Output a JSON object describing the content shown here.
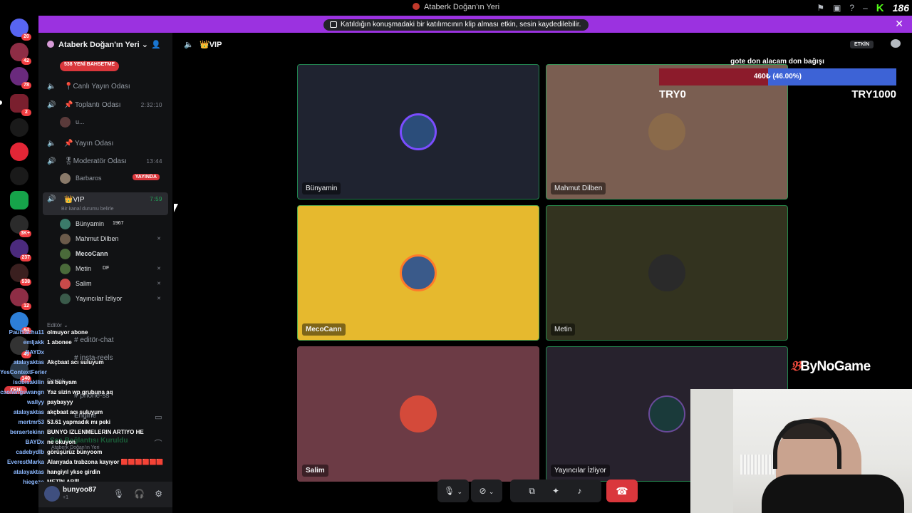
{
  "window": {
    "title": "Ataberk Doğan'ın Yeri",
    "kick_count": "186"
  },
  "notice": {
    "text": "Katıldığın konuşmadaki bir katılımcının klip alması etkin, sesin kaydedilebilir."
  },
  "server_rail": {
    "badges": [
      "20",
      "42",
      "78",
      "2",
      "3K+",
      "237",
      "538",
      "12",
      "64",
      "49",
      "140"
    ]
  },
  "sidebar": {
    "server_name": "Ataberk Doğan'ın Yeri",
    "promo_label": "538 YENİ BAHSETME",
    "channels": [
      {
        "name": "📍Canlı Yayın Odası"
      },
      {
        "name": "📌 Toplantı Odası",
        "time": "2:32:10"
      },
      {
        "name": "📌 Yayın Odası"
      },
      {
        "name": "🎖Moderatör Odası",
        "time": "13:44"
      },
      {
        "name": "👑VIP",
        "time": "7:59",
        "status": "Bir kanal durumu belirle"
      }
    ],
    "toplanti_user": "u...",
    "moderator_user": "Barbaros",
    "live_label": "YAYINDA",
    "vip_users": [
      {
        "name": "Bünyamin",
        "tag": "1967"
      },
      {
        "name": "Mahmut Dilben"
      },
      {
        "name": "MecoCann"
      },
      {
        "name": "Metin",
        "tag": "DF"
      },
      {
        "name": "Salim"
      },
      {
        "name": "Yayıncılar İzliyor"
      }
    ],
    "categories": [
      "Editör",
      "Destek"
    ],
    "text_channels": [
      "editör-chat",
      "insta-reels",
      "phone-ss",
      "Engine"
    ],
    "voice_status": "Ses Bağlantısı Kuruldu",
    "voice_sub": "Ataberk Doğan'ın Yeri",
    "new_label": "YENİ"
  },
  "user_panel": {
    "username": "bunyoo87",
    "status": "+1"
  },
  "chat_overlay": {
    "messages": [
      {
        "user": "PaulSachu11",
        "text": "olmuyor abone"
      },
      {
        "user": "emljakk",
        "text": "1 abonee"
      },
      {
        "user": "BAYDx",
        "text": ""
      },
      {
        "user": "atalayaktas",
        "text": "Akçbaat acı suluyum"
      },
      {
        "user": "YesContextFerier",
        "text": ""
      },
      {
        "user": "isobisakilin",
        "text": "sa bunyam"
      },
      {
        "user": "caolwngswangn",
        "text": "Yaz sizin wp grubuna aq"
      },
      {
        "user": "wallyy",
        "text": "paybayyy"
      },
      {
        "user": "atalayaktas",
        "text": "akçbaat acı suluyum"
      },
      {
        "user": "mertmr53",
        "text": "53.61 yapmadık mı peki"
      },
      {
        "user": "beraertekinn",
        "text": "BUNYO IZLENMELERIN ARTIYO HE"
      },
      {
        "user": "BAYDx",
        "text": "ne okuyon"
      },
      {
        "user": "cadebydlb",
        "text": "görüşürüz bünyoom"
      },
      {
        "user": "EverestMarka",
        "text": "Alanyada trabzona kayıyor 🟥🟥🟥🟥🟥🟥"
      },
      {
        "user": "atalayaktas",
        "text": "hangiyıl ykse girdin"
      },
      {
        "user": "hiegezo",
        "text": "METİN ABİİİ"
      }
    ]
  },
  "stage": {
    "channel": "👑VIP",
    "active_label": "ETKİN",
    "tiles": [
      {
        "name": "Bünyamin",
        "bg": "#1f2330"
      },
      {
        "name": "Mahmut Dilben",
        "bg": "#7a5e51"
      },
      {
        "name": "MecoCann",
        "bg": "#e6b92e"
      },
      {
        "name": "Metin",
        "bg": "#33331f"
      },
      {
        "name": "Salim",
        "bg": "#6c3b45"
      },
      {
        "name": "Yayıncılar İzliyor",
        "bg": "#27222d"
      }
    ],
    "controls": [
      "mic",
      "video",
      "screen-share",
      "activities",
      "soundboard",
      "more",
      "end-call"
    ]
  },
  "donation": {
    "title": "gote don alacam don bağışı",
    "progress_text": "460₺ (46.00%)",
    "progress": 0.46,
    "min_label": "TRY0",
    "max_label": "TRY1000"
  },
  "logo": {
    "text": "ByNoGame"
  },
  "colors": {
    "accent_purple": "#9b32e0",
    "speaking_green": "#23a55a",
    "danger_red": "#da373c"
  }
}
